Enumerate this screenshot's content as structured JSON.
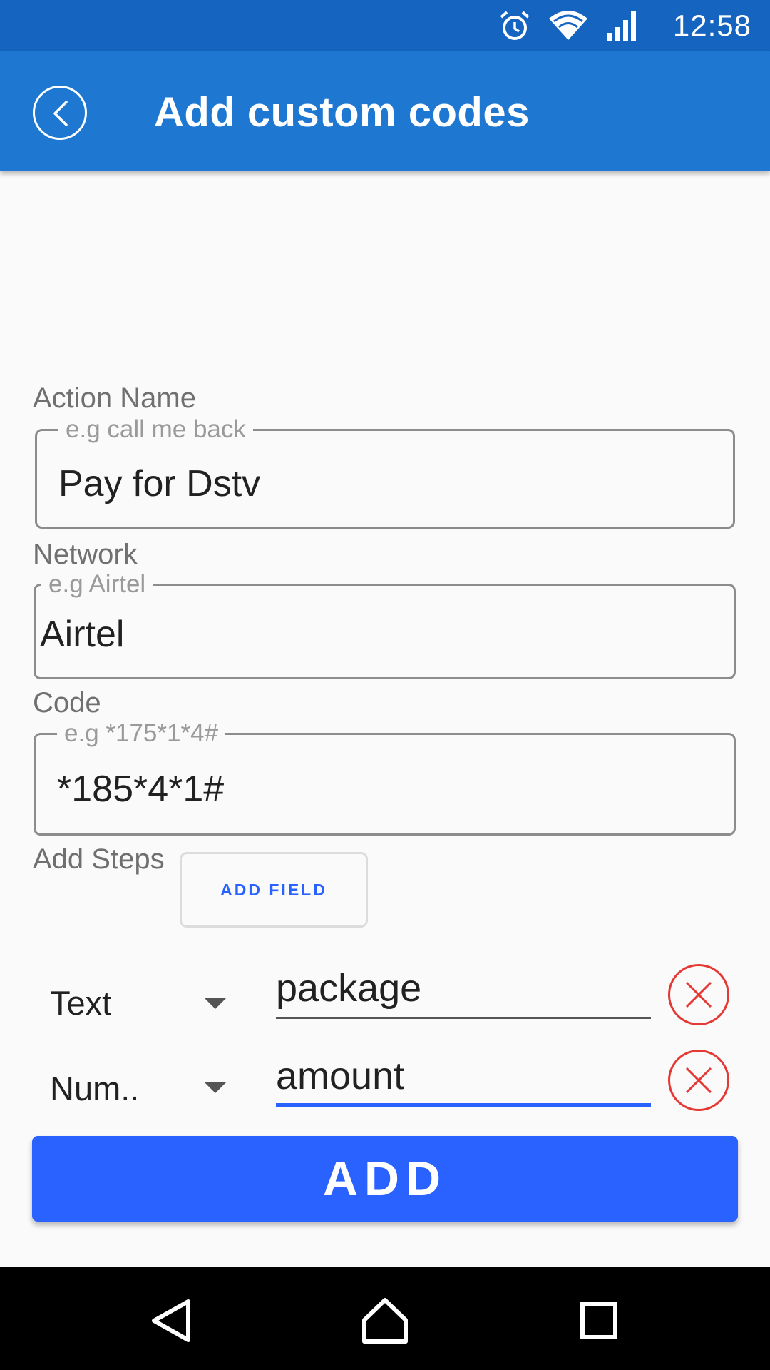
{
  "status_bar": {
    "time": "12:58",
    "icons": [
      "alarm-icon",
      "wifi-icon",
      "cell-signal-icon"
    ],
    "background": "#1565c0"
  },
  "app_bar": {
    "title": "Add custom codes",
    "back_icon": "back-arrow-icon",
    "background": "#1e78d2"
  },
  "form": {
    "action_name": {
      "label": "Action Name",
      "placeholder": "e.g call me back",
      "value": "Pay for Dstv"
    },
    "network": {
      "label": "Network",
      "placeholder": "e.g Airtel",
      "value": "Airtel"
    },
    "code": {
      "label": "Code",
      "placeholder": "e.g *175*1*4#",
      "value": "*185*4*1#"
    },
    "steps": {
      "label": "Add Steps",
      "add_field_label": "ADD FIELD",
      "items": [
        {
          "type": "Text",
          "value": "package",
          "active": false
        },
        {
          "type": "Num..",
          "value": "amount",
          "active": true
        }
      ]
    }
  },
  "submit_label": "ADD",
  "accent_color": "#2962ff",
  "remove_color": "#e53935",
  "nav_bar": {
    "icons": [
      "back-triangle-icon",
      "home-icon",
      "recents-square-icon"
    ]
  }
}
